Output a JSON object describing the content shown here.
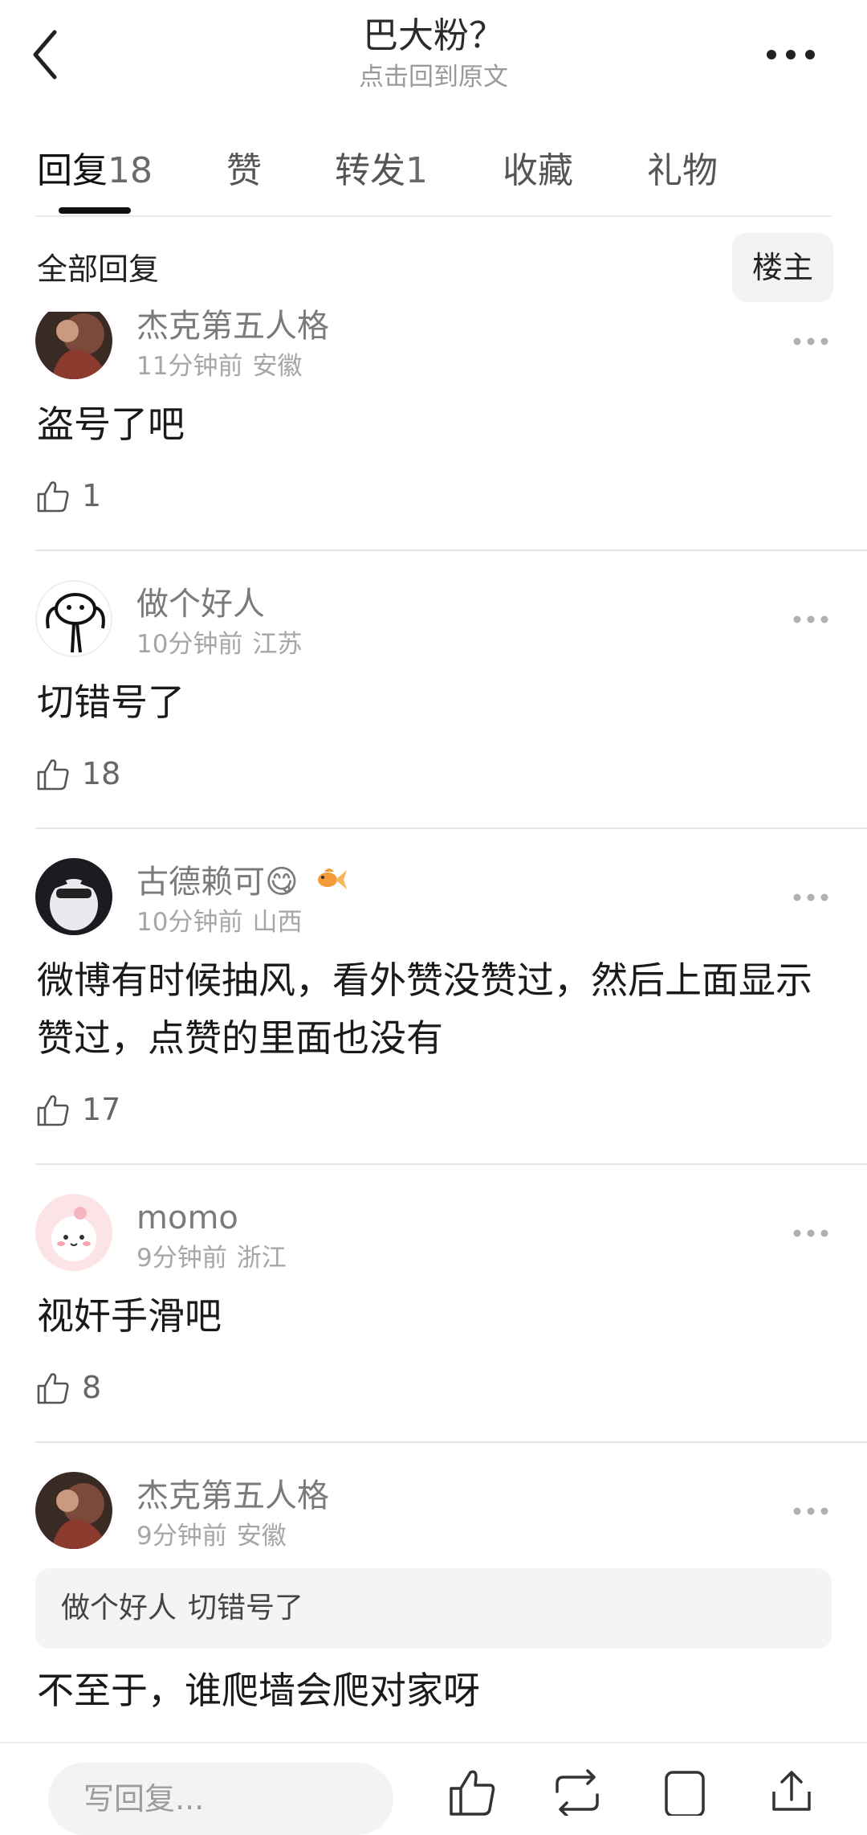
{
  "nav": {
    "title": "巴大粉？",
    "subtitle": "点击回到原文"
  },
  "tabs": [
    {
      "label": "回复",
      "count": "18",
      "active": true
    },
    {
      "label": "赞",
      "count": ""
    },
    {
      "label": "转发",
      "count": "1"
    },
    {
      "label": "收藏",
      "count": ""
    },
    {
      "label": "礼物",
      "count": ""
    }
  ],
  "list_header": {
    "title": "全部回复",
    "filter_button": "楼主"
  },
  "comments": [
    {
      "user": "杰克第五人格",
      "time": "11分钟前",
      "location": "安徽",
      "text": "盗号了吧",
      "likes": "1"
    },
    {
      "user": "做个好人",
      "time": "10分钟前",
      "location": "江苏",
      "text": "切错号了",
      "likes": "18"
    },
    {
      "user": "古德赖可😋",
      "time": "10分钟前",
      "location": "山西",
      "text": "微博有时候抽风，看外赞没赞过，然后上面显示赞过，点赞的里面也没有",
      "likes": "17"
    },
    {
      "user": "momo",
      "time": "9分钟前",
      "location": "浙江",
      "text": "视奸手滑吧",
      "likes": "8"
    },
    {
      "user": "杰克第五人格",
      "time": "9分钟前",
      "location": "安徽",
      "quote_user": "做个好人",
      "quote_text": "切错号了",
      "text": "不至于，谁爬墙会爬对家呀"
    }
  ],
  "bottom_bar": {
    "reply_placeholder": "写回复..."
  }
}
